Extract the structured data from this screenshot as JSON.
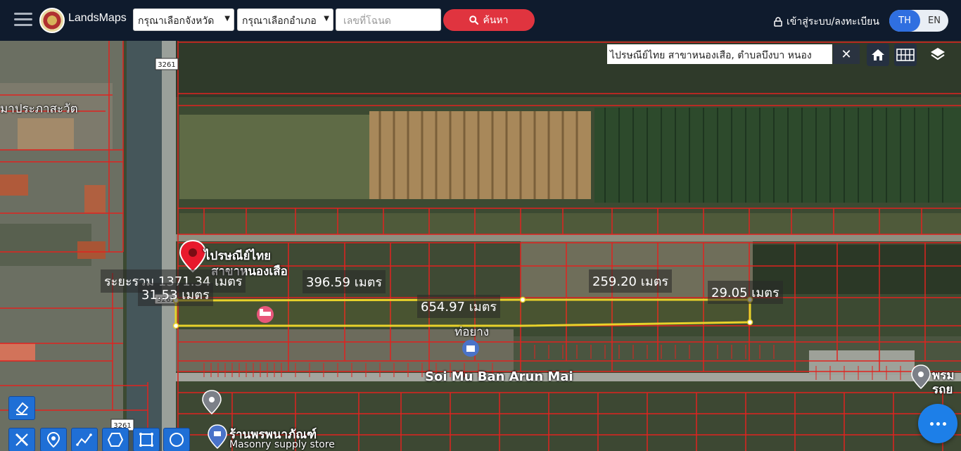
{
  "app": {
    "brand": "LandsMaps"
  },
  "header": {
    "province_select": "กรุณาเลือกจังหวัด",
    "district_select": "กรุณาเลือกอำเภอ",
    "deed_placeholder": "เลขที่โฉนด",
    "search_button": "ค้นหา",
    "login_label": "เข้าสู่ระบบ/ลงทะเบียน",
    "lang_th": "TH",
    "lang_en": "EN"
  },
  "map": {
    "search_result": "ไปรษณีย์ไทย สาขาหนองเสือ, ตำบลบึงบา หนอง",
    "road_labels": {
      "temple": "มาประภาสะวัต",
      "post_office": "ไปรษณีย์ไทย",
      "post_office_sub": "สาขาหนองเสือ",
      "road_name": "Soi Mu Ban Arun Mai",
      "place_1": "ท่อยาง",
      "shop": "ร้านพรพนาภัณฑ์",
      "shop_type": "Masonry supply store",
      "right_place": "พรม",
      "right_place_2": "รถย",
      "route_1": "3261",
      "route_2": "3261",
      "route_3": "3261"
    },
    "measurements": {
      "total": "ระยะรวม 1371.34 เมตร",
      "seg_left": "31.53 เมตร",
      "seg_top_1": "396.59 เมตร",
      "seg_top_2": "259.20 เมตร",
      "seg_right": "29.05 เมตร",
      "seg_bottom": "654.97 เมตร"
    },
    "controls": [
      "home-icon",
      "grid-icon",
      "layers-icon"
    ],
    "tools": [
      "eraser-icon",
      "ruler-icon",
      "pin-icon",
      "polyline-icon",
      "polygon-icon",
      "rectangle-icon",
      "circle-icon"
    ],
    "colors": {
      "parcel_line": "#e0231f",
      "measure_line": "#e8d22a",
      "accent_blue": "#1f6fd6",
      "search_red": "#e0343f"
    }
  }
}
